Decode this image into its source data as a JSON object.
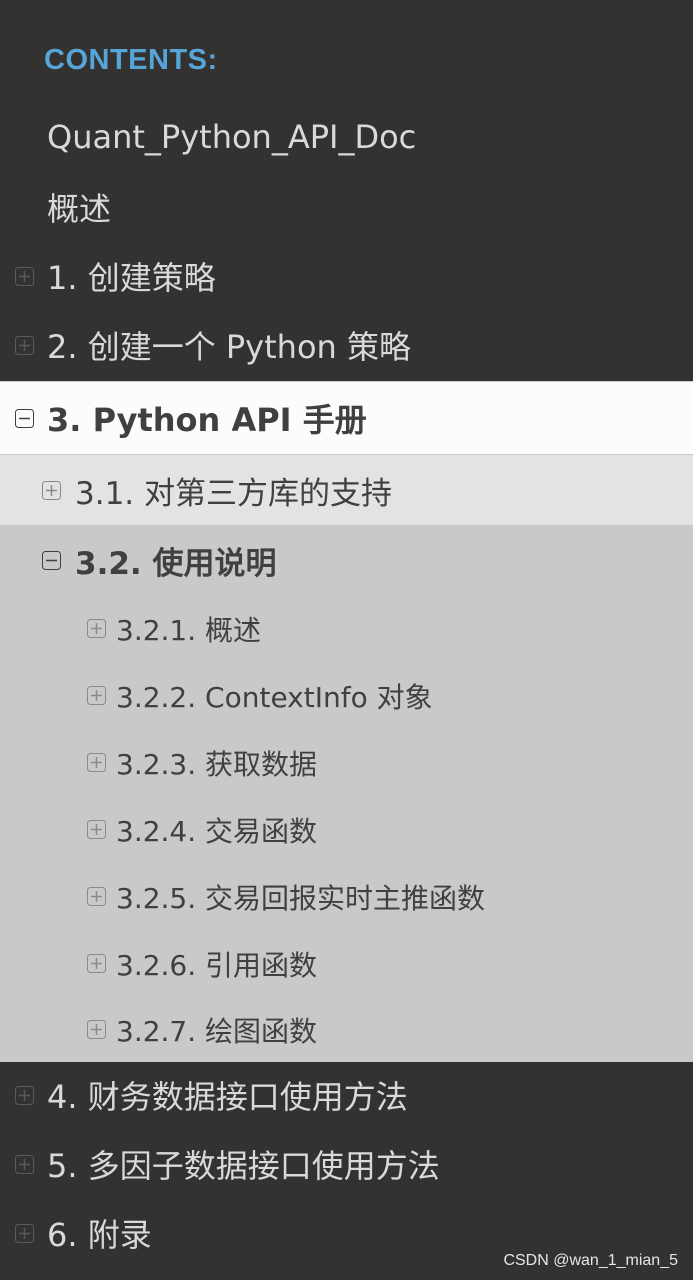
{
  "caption": "CONTENTS:",
  "top_items": [
    {
      "label": "Quant_Python_API_Doc"
    },
    {
      "label": "概述"
    },
    {
      "label": "1. 创建策略"
    },
    {
      "label": "2. 创建一个 Python 策略"
    }
  ],
  "current": {
    "label": "3. Python API 手册"
  },
  "level2": [
    {
      "label": "3.1. 对第三方库的支持"
    },
    {
      "label": "3.2. 使用说明"
    }
  ],
  "level3": [
    {
      "label": "3.2.1. 概述"
    },
    {
      "label": "3.2.2. ContextInfo 对象"
    },
    {
      "label": "3.2.3. 获取数据"
    },
    {
      "label": "3.2.4. 交易函数"
    },
    {
      "label": "3.2.5. 交易回报实时主推函数"
    },
    {
      "label": "3.2.6. 引用函数"
    },
    {
      "label": "3.2.7. 绘图函数"
    }
  ],
  "bottom_items": [
    {
      "label": "4. 财务数据接口使用方法"
    },
    {
      "label": "5. 多因子数据接口使用方法"
    },
    {
      "label": "6. 附录"
    }
  ],
  "watermark": "CSDN @wan_1_mian_5"
}
